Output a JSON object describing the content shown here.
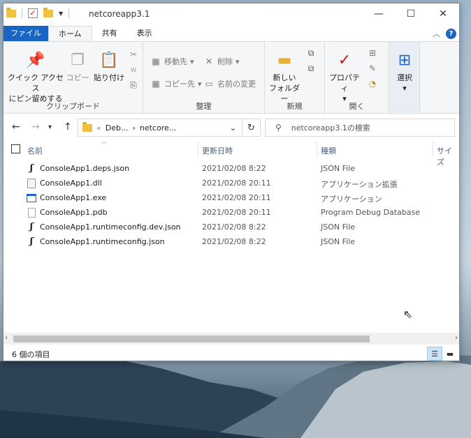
{
  "window": {
    "title": "netcoreapp3.1",
    "controls": {
      "minimize": "—",
      "maximize": "☐",
      "close": "✕"
    }
  },
  "ribbon_tabs": {
    "file": "ファイル",
    "home": "ホーム",
    "share": "共有",
    "view": "表示"
  },
  "ribbon": {
    "clipboard": {
      "pin_label_1": "クイック アクセス",
      "pin_label_2": "にピン留めする",
      "copy": "コピー",
      "paste": "貼り付け",
      "group": "クリップボード"
    },
    "organize": {
      "move_to": "移動先",
      "copy_to": "コピー先",
      "delete": "削除",
      "rename": "名前の変更",
      "group": "整理"
    },
    "new": {
      "new_folder_1": "新しい",
      "new_folder_2": "フォルダー",
      "group": "新規"
    },
    "open": {
      "properties": "プロパティ",
      "group": "開く"
    },
    "select": {
      "select": "選択"
    }
  },
  "address": {
    "path_prefix": "«",
    "segments": [
      "Deb...",
      "netcore..."
    ],
    "search_placeholder": "netcoreapp3.1の検索"
  },
  "columns": {
    "name": "名前",
    "date": "更新日時",
    "type": "種類",
    "size": "サイズ"
  },
  "files": [
    {
      "icon": "json-file-icon",
      "name": "ConsoleApp1.deps.json",
      "date": "2021/02/08 8:22",
      "type": "JSON File"
    },
    {
      "icon": "dll-file-icon",
      "name": "ConsoleApp1.dll",
      "date": "2021/02/08 20:11",
      "type": "アプリケーション拡張"
    },
    {
      "icon": "exe-file-icon",
      "name": "ConsoleApp1.exe",
      "date": "2021/02/08 20:11",
      "type": "アプリケーション"
    },
    {
      "icon": "pdb-file-icon",
      "name": "ConsoleApp1.pdb",
      "date": "2021/02/08 20:11",
      "type": "Program Debug Database"
    },
    {
      "icon": "json-file-icon",
      "name": "ConsoleApp1.runtimeconfig.dev.json",
      "date": "2021/02/08 8:22",
      "type": "JSON File"
    },
    {
      "icon": "json-file-icon",
      "name": "ConsoleApp1.runtimeconfig.json",
      "date": "2021/02/08 8:22",
      "type": "JSON File"
    }
  ],
  "status": {
    "item_count": "6 個の項目"
  },
  "colors": {
    "accent": "#1a64c4",
    "selected_view": "#cce4f7"
  }
}
